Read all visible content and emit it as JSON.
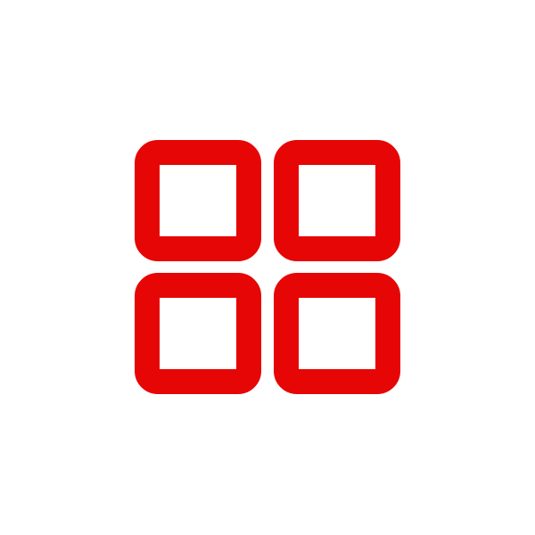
{
  "icon": {
    "name": "grid-icon",
    "color": "#e60606",
    "background": "#ffffff"
  }
}
